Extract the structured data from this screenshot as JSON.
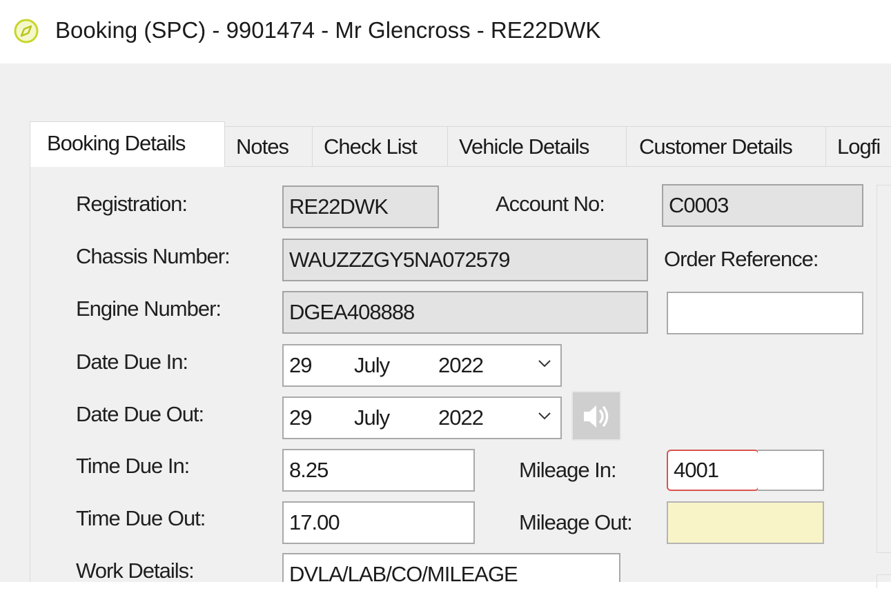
{
  "window": {
    "title": "Booking (SPC) - 9901474 - Mr Glencross - RE22DWK",
    "icon": "compass-icon"
  },
  "tabs": [
    {
      "label": "Booking Details",
      "active": true
    },
    {
      "label": "Notes",
      "active": false
    },
    {
      "label": "Check List",
      "active": false
    },
    {
      "label": "Vehicle Details",
      "active": false
    },
    {
      "label": "Customer Details",
      "active": false
    },
    {
      "label": "Logfi",
      "active": false
    }
  ],
  "form": {
    "registration": {
      "label": "Registration:",
      "value": "RE22DWK"
    },
    "account_no": {
      "label": "Account No:",
      "value": "C0003"
    },
    "chassis_number": {
      "label": "Chassis Number:",
      "value": "WAUZZZGY5NA072579"
    },
    "order_reference": {
      "label": "Order Reference:",
      "value": ""
    },
    "engine_number": {
      "label": "Engine Number:",
      "value": "DGEA408888"
    },
    "date_due_in": {
      "label": "Date Due In:",
      "day": "29",
      "month": "July",
      "year": "2022"
    },
    "date_due_out": {
      "label": "Date Due Out:",
      "day": "29",
      "month": "July",
      "year": "2022"
    },
    "time_due_in": {
      "label": "Time Due In:",
      "value": "8.25"
    },
    "mileage_in": {
      "label": "Mileage In:",
      "value": "4001"
    },
    "time_due_out": {
      "label": "Time Due Out:",
      "value": "17.00"
    },
    "mileage_out": {
      "label": "Mileage Out:",
      "value": ""
    },
    "work_details": {
      "label": "Work Details:",
      "value": "DVLA/LAB/CO/MILEAGE"
    }
  },
  "colors": {
    "highlight_border": "#d9534f",
    "mileage_out_bg": "#f8f4c8",
    "readonly_bg": "#e3e3e3",
    "title_icon": "#c8d62b"
  },
  "icons": {
    "dropdown": "chevron-down-icon",
    "speaker": "speaker-icon"
  }
}
